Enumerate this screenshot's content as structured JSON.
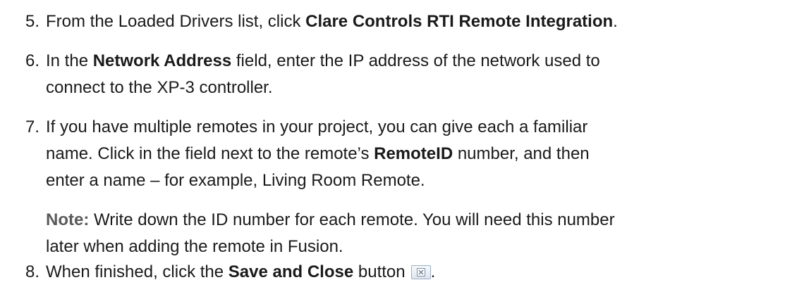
{
  "steps": [
    {
      "number": "5.",
      "lines": [
        {
          "pre": "From the Loaded Drivers list, click ",
          "bold": "Clare Controls RTI Remote Integration",
          "post": "."
        }
      ]
    },
    {
      "number": "6.",
      "lines": [
        {
          "pre": "In the ",
          "bold": "Network Address",
          "post": " field, enter the IP address of the network used to"
        },
        {
          "text": "connect to the XP-3 controller."
        }
      ]
    },
    {
      "number": "7.",
      "lines": [
        {
          "text": "If you have multiple remotes in your project, you can give each a familiar"
        },
        {
          "pre": "name. Click in the field next to the remote’s ",
          "bold": "RemoteID",
          "post": " number, and then"
        },
        {
          "text": "enter a name – for example, Living Room Remote."
        }
      ],
      "note": {
        "label": "Note:",
        "line1": " Write down the ID number for each remote. You will need this number",
        "line2": "later when adding the remote in Fusion."
      }
    },
    {
      "number": "8.",
      "lines": [
        {
          "pre": "When finished, click the ",
          "bold": "Save and Close",
          "post": " button"
        }
      ],
      "trailing": ".",
      "button_icon": "save-and-close-icon"
    }
  ]
}
